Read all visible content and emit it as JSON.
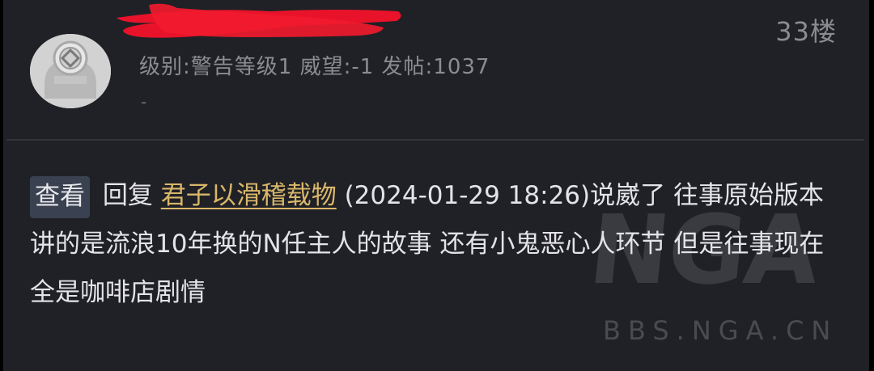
{
  "post": {
    "floor": "33楼",
    "user_stats": "级别:警告等级1 威望:-1 发帖:1037",
    "signature": "-"
  },
  "reply": {
    "view_button": "查看",
    "reply_label": "回复",
    "author": "君子以滑稽载物",
    "timestamp": "(2024-01-29 18:26)",
    "body": "说崴了 往事原始版本讲的是流浪10年换的N任主人的故事 还有小鬼恶心人环节 但是往事现在全是咖啡店剧情"
  },
  "watermark": {
    "logo": "NGA",
    "url": "BBS.NGA.CN"
  },
  "colors": {
    "background": "#202126",
    "link": "#d9b76a",
    "muted": "#8b8c92",
    "redaction": "#e8132a"
  },
  "icons": {
    "avatar": "default-avatar-icon"
  }
}
